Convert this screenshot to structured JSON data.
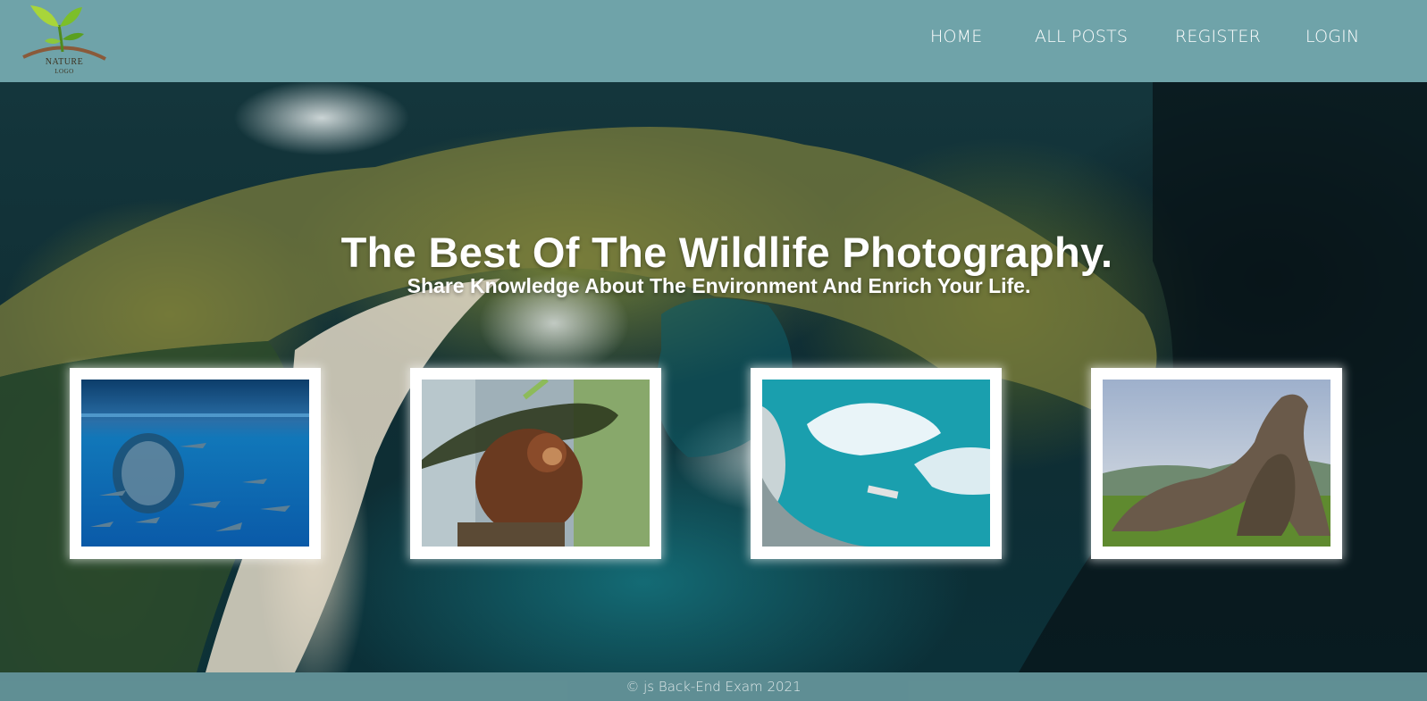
{
  "header": {
    "logo": {
      "title": "NATURE",
      "subtitle": "LOGO"
    },
    "nav": [
      {
        "label": "HOME"
      },
      {
        "label": "ALL POSTS"
      },
      {
        "label": "REGISTER"
      },
      {
        "label": "LOGIN"
      }
    ]
  },
  "hero": {
    "title": "The Best Of The Wildlife Photography.",
    "subtitle": "Share Knowledge About The Environment And Enrich Your Life."
  },
  "gallery": [
    {
      "icon": "dolphins-photo"
    },
    {
      "icon": "orangutan-photo"
    },
    {
      "icon": "iceberg-photo"
    },
    {
      "icon": "komodo-dragons-photo"
    }
  ],
  "footer": {
    "text": "© js Back-End Exam 2021"
  },
  "colors": {
    "header_bg": "#6fa3a9",
    "footer_bg": "#6fa3a9",
    "card_frame": "#ffffff",
    "text": "#ffffff"
  }
}
